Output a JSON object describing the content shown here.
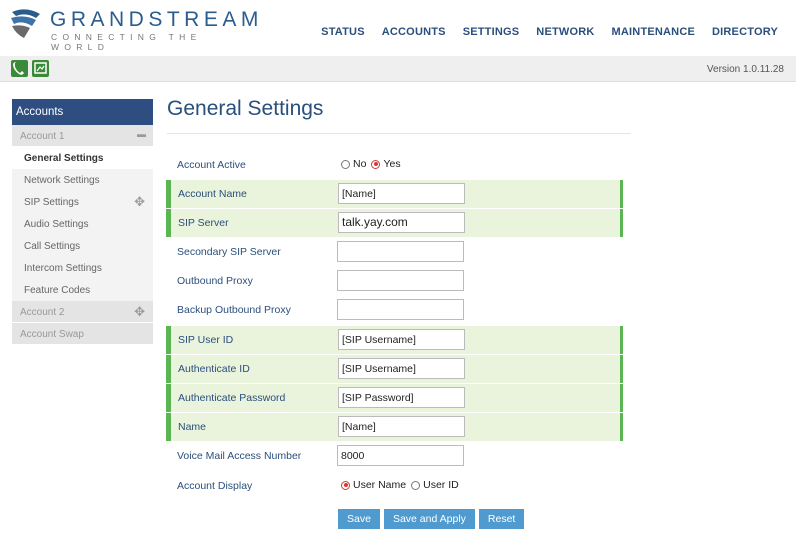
{
  "brand": {
    "name": "GRANDSTREAM",
    "tagline": "CONNECTING THE WORLD"
  },
  "nav": [
    "STATUS",
    "ACCOUNTS",
    "SETTINGS",
    "NETWORK",
    "MAINTENANCE",
    "DIRECTORY"
  ],
  "toolbar": {
    "version": "Version 1.0.11.28",
    "icons": [
      "phone-icon",
      "message-icon"
    ]
  },
  "sidebar": {
    "header": "Accounts",
    "account1": "Account 1",
    "items": [
      "General Settings",
      "Network Settings",
      "SIP Settings",
      "Audio Settings",
      "Call Settings",
      "Intercom Settings",
      "Feature Codes"
    ],
    "account2": "Account 2",
    "swap": "Account Swap"
  },
  "page": {
    "title": "General Settings"
  },
  "form": {
    "account_active": {
      "label": "Account Active",
      "no": "No",
      "yes": "Yes",
      "selected": "Yes"
    },
    "account_name": {
      "label": "Account Name",
      "value": "[Name]"
    },
    "sip_server": {
      "label": "SIP Server",
      "value": "talk.yay.com"
    },
    "secondary_sip_server": {
      "label": "Secondary SIP Server",
      "value": ""
    },
    "outbound_proxy": {
      "label": "Outbound Proxy",
      "value": ""
    },
    "backup_outbound_proxy": {
      "label": "Backup Outbound Proxy",
      "value": ""
    },
    "sip_user_id": {
      "label": "SIP User ID",
      "value": "[SIP Username]"
    },
    "authenticate_id": {
      "label": "Authenticate ID",
      "value": "[SIP Username]"
    },
    "authenticate_password": {
      "label": "Authenticate Password",
      "value": "[SIP Password]"
    },
    "name": {
      "label": "Name",
      "value": "[Name]"
    },
    "voice_mail": {
      "label": "Voice Mail Access Number",
      "value": "8000"
    },
    "account_display": {
      "label": "Account Display",
      "user_name": "User Name",
      "user_id": "User ID",
      "selected": "User Name"
    }
  },
  "buttons": {
    "save": "Save",
    "save_apply": "Save and Apply",
    "reset": "Reset"
  },
  "colors": {
    "accent": "#2e4e82",
    "highlight_row": "#eaf3dc",
    "highlight_bar": "#5ab552",
    "button": "#4f9bd0",
    "radio_on": "#d23b3b"
  }
}
